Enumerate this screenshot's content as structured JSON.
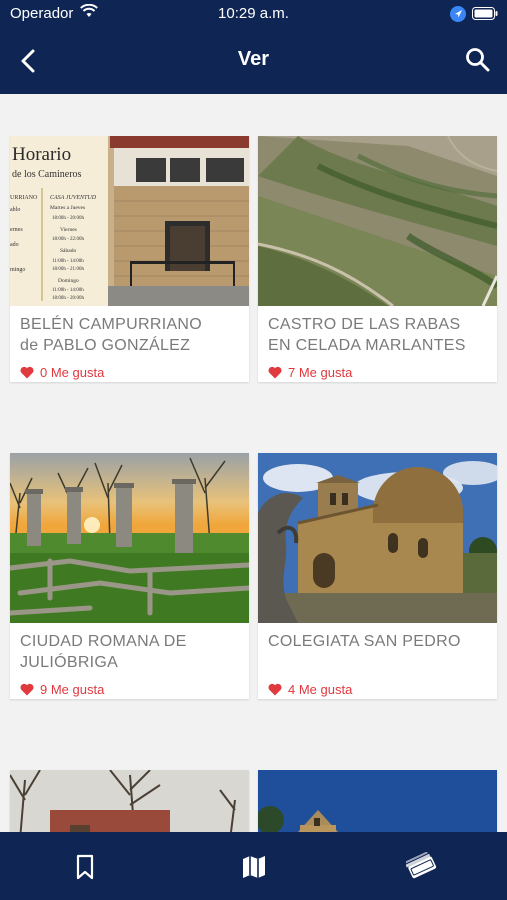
{
  "status_bar": {
    "carrier": "Operador",
    "time": "10:29 a.m.",
    "icons": [
      "wifi-icon",
      "location-arrow-icon",
      "battery-icon"
    ]
  },
  "nav": {
    "title": "Ver",
    "back_icon": "chevron-left-icon",
    "search_icon": "search-icon"
  },
  "cards": [
    {
      "name_line1": "BELÉN CAMPURRIANO",
      "name_line2": "de PABLO GONZÁLEZ",
      "likes": "0 Me gusta",
      "poster": {
        "title": "Horario",
        "subtitle": "de los Camineros",
        "left_words": [
          "URRIANO",
          "ablo",
          "ernes",
          "ado",
          "mingo"
        ],
        "right_lines": [
          "CASA JUVENTUD",
          "Martes a Jueves",
          "18:00h - 20:00h",
          "Viernes",
          "18:00h - 22:00h",
          "Sábado",
          "11:00h - 14:00h",
          "18:00h - 21:00h",
          "Domingo",
          "11:00h - 14:00h",
          "18:00h - 20:00h"
        ]
      }
    },
    {
      "name_line1": "CASTRO DE LAS RABAS",
      "name_line2": "EN CELADA MARLANTES",
      "likes": "7 Me gusta"
    },
    {
      "name_line1": "CIUDAD ROMANA DE",
      "name_line2": "JULIÓBRIGA",
      "likes": "9 Me gusta"
    },
    {
      "name_line1": "COLEGIATA SAN PEDRO",
      "name_line2": "",
      "likes": "4 Me gusta"
    }
  ],
  "tabbar": {
    "tabs": [
      {
        "icon": "bookmark-icon"
      },
      {
        "icon": "map-icon"
      },
      {
        "icon": "tickets-icon"
      }
    ]
  },
  "colors": {
    "navy": "#0f2554",
    "like_red": "#e0393e",
    "card_text": "#7a7a7a",
    "background": "#f2f2f2"
  }
}
